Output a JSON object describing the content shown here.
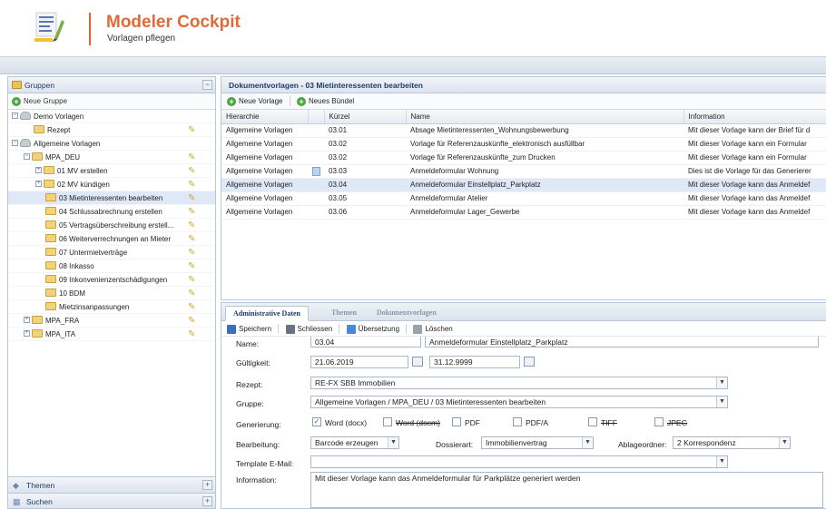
{
  "app": {
    "title": "Modeler Cockpit",
    "subtitle": "Vorlagen pflegen"
  },
  "left_panel": {
    "header": "Gruppen",
    "collapse_symbol": "−",
    "new_group_label": "Neue Gruppe",
    "tree": [
      {
        "label": "Demo Vorlagen",
        "level": 0,
        "kind": "group",
        "expand": "−",
        "edit": false
      },
      {
        "label": "Rezept",
        "level": 1,
        "kind": "folder",
        "expand": "",
        "edit": true
      },
      {
        "label": "Allgemeine Vorlagen",
        "level": 0,
        "kind": "group",
        "expand": "−",
        "edit": false
      },
      {
        "label": "MPA_DEU",
        "level": 1,
        "kind": "folder",
        "expand": "−",
        "edit": true
      },
      {
        "label": "01 MV erstellen",
        "level": 2,
        "kind": "folder",
        "expand": "+",
        "edit": true
      },
      {
        "label": "02 MV kündigen",
        "level": 2,
        "kind": "folder",
        "expand": "+",
        "edit": true
      },
      {
        "label": "03 Mietinteressenten bearbeiten",
        "level": 2,
        "kind": "folder",
        "expand": "",
        "edit": true,
        "selected": true
      },
      {
        "label": "04 Schlussabrechnung erstellen",
        "level": 2,
        "kind": "folder",
        "expand": "",
        "edit": true
      },
      {
        "label": "05 Vertragsüberschreibung erstell...",
        "level": 2,
        "kind": "folder",
        "expand": "",
        "edit": true
      },
      {
        "label": "06 Weiterverrechnungen an Mieter",
        "level": 2,
        "kind": "folder",
        "expand": "",
        "edit": true
      },
      {
        "label": "07 Untermietverträge",
        "level": 2,
        "kind": "folder",
        "expand": "",
        "edit": true
      },
      {
        "label": "08 Inkasso",
        "level": 2,
        "kind": "folder",
        "expand": "",
        "edit": true
      },
      {
        "label": "09 Inkonvenienzentschädigungen",
        "level": 2,
        "kind": "folder",
        "expand": "",
        "edit": true
      },
      {
        "label": "10 BDM",
        "level": 2,
        "kind": "folder",
        "expand": "",
        "edit": true
      },
      {
        "label": "Mietzinsanpassungen",
        "level": 2,
        "kind": "folder",
        "expand": "",
        "edit": true
      },
      {
        "label": "MPA_FRA",
        "level": 1,
        "kind": "folder",
        "expand": "+",
        "edit": true
      },
      {
        "label": "MPA_ITA",
        "level": 1,
        "kind": "folder",
        "expand": "+",
        "edit": true
      }
    ],
    "themen_label": "Themen",
    "suchen_label": "Suchen",
    "plus_symbol": "+"
  },
  "grid": {
    "title": "Dokumentvorlagen - 03 Mietinteressenten bearbeiten",
    "new_template_label": "Neue Vorlage",
    "new_bundle_label": "Neues Bündel",
    "columns": [
      "Hierarchie",
      "",
      "Kürzel",
      "Name",
      "Information"
    ],
    "rows": [
      {
        "hierarchy": "Allgemeine Vorlagen",
        "icon": false,
        "code": "03.01",
        "name": "Absage Mietinteressenten_Wohnungsbewerbung",
        "info": "Mit dieser Vorlage kann der Brief für d"
      },
      {
        "hierarchy": "Allgemeine Vorlagen",
        "icon": false,
        "code": "03.02",
        "name": "Vorlage für Referenzauskünfte_elektronisch ausfüllbar",
        "info": "Mit dieser Vorlage kann ein Formular"
      },
      {
        "hierarchy": "Allgemeine Vorlagen",
        "icon": false,
        "code": "03.02",
        "name": "Vorlage für Referenzauskünfte_zum Drucken",
        "info": "Mit dieser Vorlage kann ein Formular"
      },
      {
        "hierarchy": "Allgemeine Vorlagen",
        "icon": true,
        "code": "03.03",
        "name": "Anmeldeformular Wohnung",
        "info": "Dies ist die Vorlage für das Generierer"
      },
      {
        "hierarchy": "Allgemeine Vorlagen",
        "icon": false,
        "code": "03.04",
        "name": "Anmeldeformular Einstellplatz_Parkplatz",
        "info": "Mit dieser Vorlage kann das Anmeldef",
        "selected": true
      },
      {
        "hierarchy": "Allgemeine Vorlagen",
        "icon": false,
        "code": "03.05",
        "name": "Anmeldeformular Atelier",
        "info": "Mit dieser Vorlage kann das Anmeldef"
      },
      {
        "hierarchy": "Allgemeine Vorlagen",
        "icon": false,
        "code": "03.06",
        "name": "Anmeldeformular Lager_Gewerbe",
        "info": "Mit dieser Vorlage kann das Anmeldef"
      }
    ]
  },
  "form": {
    "tabs": [
      "Administrative Daten",
      "Themen",
      "Dokumentvorlagen"
    ],
    "toolbar": {
      "save": "Speichern",
      "close": "Schliessen",
      "translate": "Übersetzung",
      "delete": "Löschen"
    },
    "name_label": "Name:",
    "name_code": "03.04",
    "name_value": "Anmeldeformular Einstellplatz_Parkplatz",
    "valid_label": "Gültigkeit:",
    "valid_from": "21.06.2019",
    "valid_to": "31.12.9999",
    "recipe_label": "Rezept:",
    "recipe_value": "RE-FX SBB Immobilien",
    "group_label": "Gruppe:",
    "group_value": "Allgemeine Vorlagen / MPA_DEU / 03 Mietinteressenten bearbeiten",
    "generation_label": "Generierung:",
    "formats": [
      {
        "label": "Word (docx)",
        "checked": true,
        "strike": false
      },
      {
        "label": "Word (docm)",
        "checked": false,
        "strike": true
      },
      {
        "label": "PDF",
        "checked": false,
        "strike": false
      },
      {
        "label": "PDF/A",
        "checked": false,
        "strike": false
      },
      {
        "label": "TIFF",
        "checked": false,
        "strike": true
      },
      {
        "label": "JPEG",
        "checked": false,
        "strike": true
      }
    ],
    "edit_label": "Bearbeitung:",
    "edit_value": "Barcode erzeugen",
    "dossier_label": "Dossierart:",
    "dossier_value": "Immobilienvertrag",
    "folder_label": "Ablageordner:",
    "folder_value": "2 Korrespondenz",
    "email_label": "Template E-Mail:",
    "email_value": "",
    "info_label": "Information:",
    "info_value": "Mit dieser Vorlage kann das Anmeldeformular für Parkplätze generiert werden",
    "dropdown_symbol": "▼",
    "check_symbol": "✓"
  },
  "colors": {
    "accent": "#e06a3a",
    "header_blue": "#1b3b6b",
    "selection": "#dfe8f6"
  }
}
